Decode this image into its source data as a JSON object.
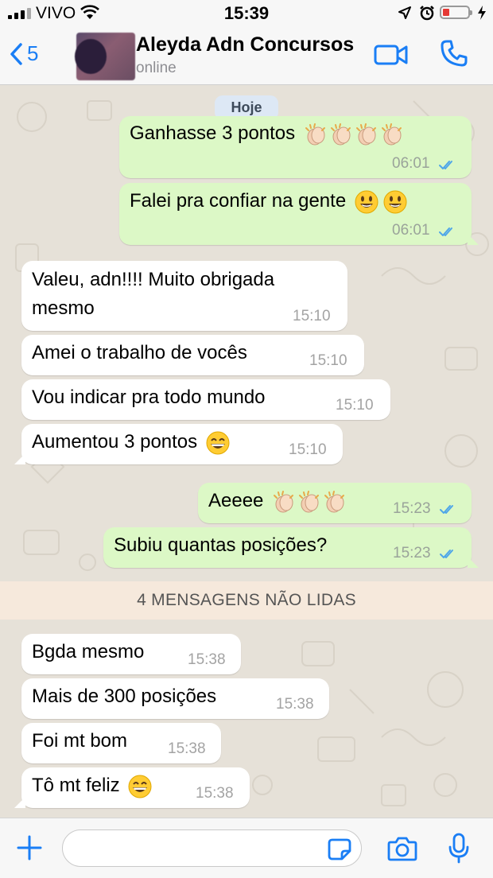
{
  "status_bar": {
    "carrier": "VIVO",
    "time": "15:39"
  },
  "header": {
    "back_count": "5",
    "contact_name": "Aleyda Adn Concursos",
    "contact_status": "online"
  },
  "chat": {
    "date_label": "Hoje",
    "unread_label": "4 MENSAGENS NÃO LIDAS",
    "messages": [
      {
        "dir": "out",
        "text": "Ganhasse 3 pontos",
        "emoji": [
          "clapping-hands",
          "clapping-hands",
          "clapping-hands",
          "clapping-hands"
        ],
        "time": "06:01",
        "status": "read"
      },
      {
        "dir": "out",
        "text": "Falei pra confiar na gente",
        "emoji": [
          "smiley-face",
          "smiley-face"
        ],
        "time": "06:01",
        "status": "read"
      },
      {
        "dir": "in",
        "text": "Valeu, adn!!!! Muito obrigada mesmo",
        "time": "15:10"
      },
      {
        "dir": "in",
        "text": "Amei o trabalho de vocês",
        "time": "15:10"
      },
      {
        "dir": "in",
        "text": "Vou indicar pra todo mundo",
        "time": "15:10"
      },
      {
        "dir": "in",
        "text": "Aumentou 3 pontos",
        "emoji": [
          "grin-face"
        ],
        "time": "15:10"
      },
      {
        "dir": "out",
        "text": "Aeeee",
        "emoji": [
          "clapping-hands",
          "clapping-hands",
          "clapping-hands"
        ],
        "time": "15:23",
        "status": "read"
      },
      {
        "dir": "out",
        "text": "Subiu quantas posições?",
        "time": "15:23",
        "status": "read"
      },
      {
        "dir": "in",
        "text": "Bgda mesmo",
        "time": "15:38"
      },
      {
        "dir": "in",
        "text": "Mais de 300 posições",
        "time": "15:38"
      },
      {
        "dir": "in",
        "text": "Foi mt bom",
        "time": "15:38"
      },
      {
        "dir": "in",
        "text": "Tô mt feliz",
        "emoji": [
          "grin-face"
        ],
        "time": "15:38"
      }
    ]
  },
  "input": {
    "value": ""
  },
  "colors": {
    "accent": "#1a7ef5",
    "outgoing_bubble": "#dcf8c6",
    "incoming_bubble": "#ffffff",
    "read_ticks": "#4fa6e8",
    "unread_bar": "#f6e9dc",
    "chat_background": "#e6e1d8"
  }
}
